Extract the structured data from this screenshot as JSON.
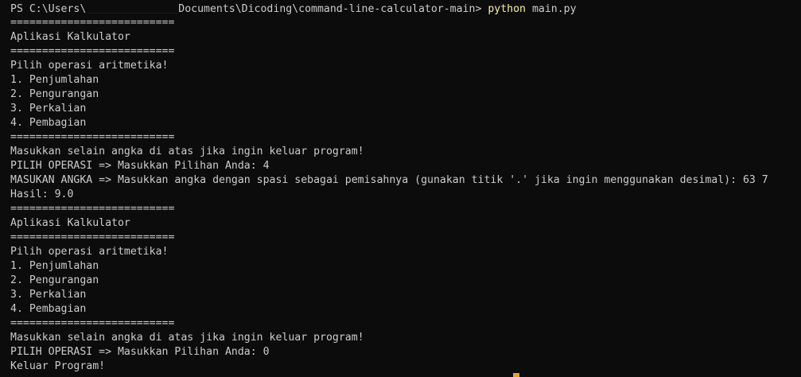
{
  "terminal": {
    "prompt": {
      "prefix": "PS C:\\Users\\",
      "suffix": "Documents\\Dicoding\\command-line-calculator-main>",
      "cmd_program": "python",
      "cmd_arg": "main.py"
    },
    "lines": [
      "==========================",
      "Aplikasi Kalkulator",
      "==========================",
      "Pilih operasi aritmetika!",
      "1. Penjumlahan",
      "2. Pengurangan",
      "3. Perkalian",
      "4. Pembagian",
      "==========================",
      "Masukkan selain angka di atas jika ingin keluar program!",
      "PILIH OPERASI => Masukkan Pilihan Anda: 4",
      "MASUKAN ANGKA => Masukkan angka dengan spasi sebagai pemisahnya (gunakan titik '.' jika ingin menggunakan desimal): 63 7",
      "Hasil: 9.0",
      "==========================",
      "Aplikasi Kalkulator",
      "==========================",
      "Pilih operasi aritmetika!",
      "1. Penjumlahan",
      "2. Pengurangan",
      "3. Perkalian",
      "4. Pembagian",
      "==========================",
      "Masukkan selain angka di atas jika ingin keluar program!",
      "PILIH OPERASI => Masukkan Pilihan Anda: 0",
      "Keluar Program!"
    ]
  }
}
